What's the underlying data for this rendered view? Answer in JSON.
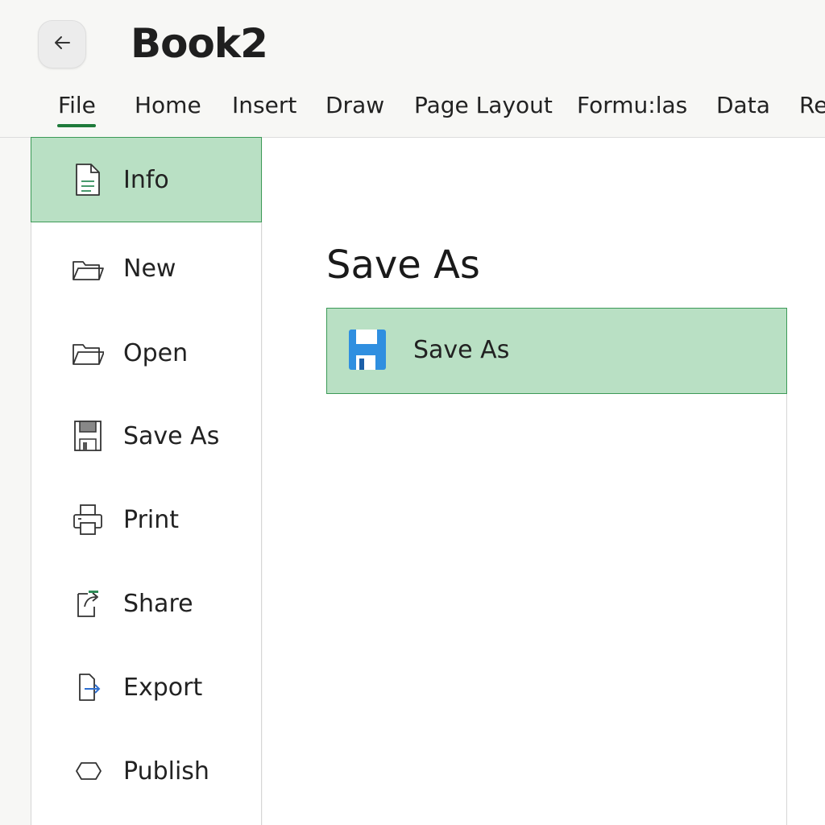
{
  "header": {
    "back_icon": "arrow-left-icon",
    "title": "Book2"
  },
  "tabs": [
    {
      "label": "File",
      "active": true
    },
    {
      "label": "Home"
    },
    {
      "label": "Insert"
    },
    {
      "label": "Draw"
    },
    {
      "label": "Page Layout"
    },
    {
      "label": "Formu:las"
    },
    {
      "label": "Data"
    },
    {
      "label": "Re"
    }
  ],
  "sidebar": {
    "items": [
      {
        "label": "Info",
        "icon": "document-icon",
        "active": true
      },
      {
        "label": "New",
        "icon": "folder-open-icon"
      },
      {
        "label": "Open",
        "icon": "folder-open-icon"
      },
      {
        "label": "Save As",
        "icon": "floppy-disk-icon"
      },
      {
        "label": "Print",
        "icon": "printer-icon"
      },
      {
        "label": "Share",
        "icon": "share-icon"
      },
      {
        "label": "Export",
        "icon": "export-icon"
      },
      {
        "label": "Publish",
        "icon": "publish-icon"
      }
    ]
  },
  "main": {
    "title": "Save As",
    "options": [
      {
        "label": "Save As",
        "icon": "floppy-disk-icon"
      }
    ]
  },
  "colors": {
    "accent_green": "#1e7a3a",
    "selected_fill": "#b9e0c4",
    "selected_border": "#3c9a57",
    "save_icon_blue": "#2f8fe0"
  }
}
